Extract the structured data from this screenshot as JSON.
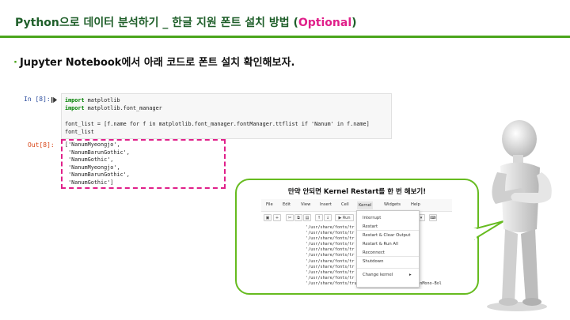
{
  "header": {
    "title_main": "Python으로 데이터 분석하기 _ 한글 지원 폰트 설치 방법 (",
    "title_optional": "Optional",
    "title_close": ")"
  },
  "bullet": {
    "marker": "·",
    "text": "Jupyter Notebook에서 아래 코드로 폰트 설치 확인해보자."
  },
  "notebook": {
    "in_prompt": "In [8]:",
    "out_prompt": "Out[8]:",
    "code_lines": [
      {
        "kw": "import",
        "rest": " matplotlib"
      },
      {
        "kw": "import",
        "rest": " matplotlib.font_manager"
      },
      {
        "kw": "",
        "rest": ""
      },
      {
        "kw": "",
        "rest": "font_list = [f.name for f in matplotlib.font_manager.fontManager.ttflist if 'Nanum' in f.name]"
      },
      {
        "kw": "",
        "rest": "font_list"
      }
    ],
    "output_lines": [
      "['NanumMyeongjo',",
      " 'NanumBarunGothic',",
      " 'NanumGothic',",
      " 'NanumMyeongjo',",
      " 'NanumBarunGothic',",
      " 'NanumGothic']"
    ]
  },
  "callout": {
    "title": "만약 안되면 Kernel Restart를 한 번 해보기!",
    "menu": [
      "File",
      "Edit",
      "View",
      "Insert",
      "Cell",
      "Kernel",
      "Widgets",
      "Help"
    ],
    "run_label": "Run",
    "kernel_menu": [
      "Interrupt",
      "Restart",
      "Restart & Clear Output",
      "Restart & Run All",
      "Reconnect",
      "Shutdown",
      "Change kernel"
    ],
    "paths": [
      "  '/usr/share/fonts/tr       ationSansNarr",
      "  '/usr/share/fonts/tr       ationMono-Bol",
      "  '/usr/share/fonts/tr       GothicBold.tt",
      "  '/usr/share/fonts/tr       ic.ttf',",
      "  '/usr/share/fonts/tr       rifCondensed-Ob",
      "  '/usr/share/fonts/tr       rifCondensed-B",
      "  '/usr/share/fonts/tr       rifCondensed-I",
      "  '/usr/share/fonts/tr       sCondensed-Bo",
      "  '/usr/share/fonts/tr       rifCondensed.t",
      "  '/usr/share/fonts/tr       ationSans-Bol",
      "  '/usr/share/fonts/truetype/liberation/LiberationMono-Bol"
    ]
  },
  "colors": {
    "header_green": "#1f5f2a",
    "accent_green": "#4aa51b",
    "optional_pink": "#e0208a"
  }
}
